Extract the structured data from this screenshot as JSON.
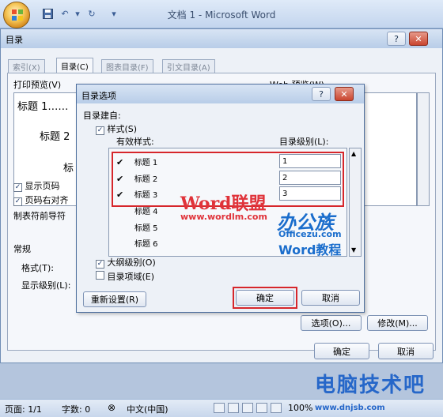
{
  "word": {
    "title": "文档 1 - Microsoft Word",
    "status": {
      "page": "页面: 1/1",
      "words": "字数: 0",
      "language": "中文(中国)",
      "zoom": "100%"
    },
    "brand": "电脑技术吧",
    "brand_url": "www.dnjsb.com"
  },
  "toc_dialog": {
    "title": "目录",
    "tabs": [
      "索引(X)",
      "目录(C)",
      "图表目录(F)",
      "引文目录(A)"
    ],
    "print_preview_label": "打印预览(V)",
    "web_preview_label": "Web 预览(W)",
    "preview_lines": [
      "标题 1……",
      "标题 2",
      "标"
    ],
    "show_page_numbers": "显示页码",
    "right_align": "页码右对齐",
    "tab_leader": "制表符前导符",
    "general": "常规",
    "format_label": "格式(T):",
    "show_levels_label": "显示级别(L):",
    "options_button": "选项(O)...",
    "modify_button": "修改(M)...",
    "ok": "确定",
    "cancel": "取消"
  },
  "options_dialog": {
    "title": "目录选项",
    "build_from": "目录建自:",
    "styles": "样式(S)",
    "available_styles": "有效样式:",
    "toc_level": "目录级别(L):",
    "rows": [
      {
        "name": "标题 1",
        "checked": true,
        "level": "1"
      },
      {
        "name": "标题 2",
        "checked": true,
        "level": "2"
      },
      {
        "name": "标题 3",
        "checked": true,
        "level": "3"
      },
      {
        "name": "标题 4",
        "checked": false,
        "level": ""
      },
      {
        "name": "标题 5",
        "checked": false,
        "level": ""
      },
      {
        "name": "标题 6",
        "checked": false,
        "level": ""
      }
    ],
    "outline_levels": "大纲级别(O)",
    "toc_entry_fields": "目录项域(E)",
    "reset": "重新设置(R)",
    "ok": "确定",
    "cancel": "取消"
  },
  "watermarks": {
    "word_union": "Word联盟",
    "word_union_url": "www.wordlm.com",
    "bangongzu": "办公族",
    "officezu": "Officezu.com",
    "word_tutorial": "Word教程"
  },
  "colors": {
    "highlight_red": "#d6262b",
    "watermark_blue": "#1a6dcc"
  }
}
